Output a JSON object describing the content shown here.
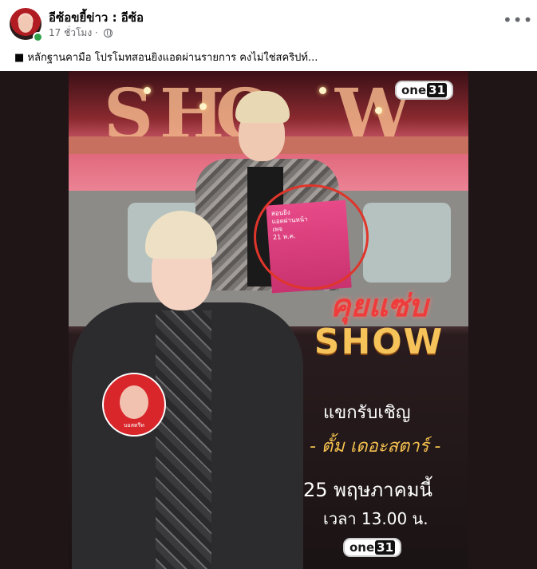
{
  "post": {
    "author": "อีซ้อขยี้ข่าว : อีซ้อ",
    "time": "17 ชั่วโมง ·",
    "caption": "■ หลักฐานคามือ โปรโมทสอนยิงแอดผ่านรายการ คงไม่ใช่สคริปท์...",
    "more_label": "•••"
  },
  "image": {
    "channel_logo_text": "one",
    "channel_logo_num": "31",
    "title_thai": "คุยแซ่บ",
    "title_show": "SHOW",
    "invite": "แขกรับเชิญ",
    "guest_name": "- ตั้ม เดอะสตาร์ -",
    "date": "25 พฤษภาคมนี้",
    "time": "เวลา 13.00 น.",
    "card_text": "สอนยิง\nแอดผ่านหน้า\nเพจ\n21 พ.ค.",
    "sticker_text": "บอสตรีท",
    "show_letters": [
      "S",
      "H",
      "O",
      "W"
    ]
  },
  "colors": {
    "accent_red": "#e0352b",
    "title_gold": "#f6c35a",
    "online": "#31a24c"
  }
}
